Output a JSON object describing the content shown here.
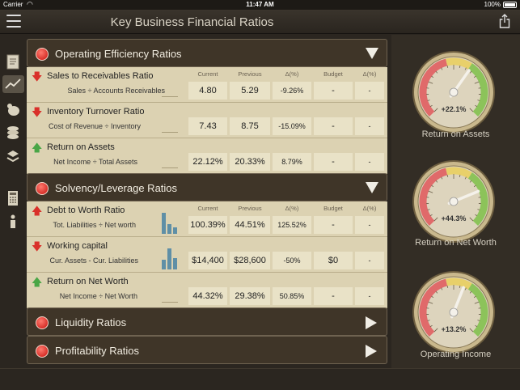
{
  "status": {
    "carrier": "Carrier",
    "time": "11:47 AM",
    "battery": "100%"
  },
  "nav": {
    "title": "Key Business Financial Ratios"
  },
  "columns": {
    "current": "Current",
    "previous": "Previous",
    "delta": "Δ(%)",
    "budget": "Budget",
    "delta_budget": "Δ(%)"
  },
  "sections": {
    "operating": {
      "title": "Operating Efficiency Ratios",
      "rows": [
        {
          "name": "Sales to Receivables Ratio",
          "formula": "Sales ÷ Accounts Receivables",
          "current": "4.80",
          "previous": "5.29",
          "delta": "-9.26%",
          "budget": "-",
          "delta_budget": "-",
          "trend": "down"
        },
        {
          "name": "Inventory Turnover Ratio",
          "formula": "Cost of Revenue ÷ Inventory",
          "current": "7.43",
          "previous": "8.75",
          "delta": "-15.09%",
          "budget": "-",
          "delta_budget": "-",
          "trend": "down"
        },
        {
          "name": "Return on Assets",
          "formula": "Net Income ÷ Total Assets",
          "current": "22.12%",
          "previous": "20.33%",
          "delta": "8.79%",
          "budget": "-",
          "delta_budget": "-",
          "trend": "up"
        }
      ]
    },
    "solvency": {
      "title": "Solvency/Leverage Ratios",
      "rows": [
        {
          "name": "Debt to Worth Ratio",
          "formula": "Tot. Liabilities ÷ Net worth",
          "current": "100.39%",
          "previous": "44.51%",
          "delta": "125.52%",
          "budget": "-",
          "delta_budget": "-",
          "trend": "up-red"
        },
        {
          "name": "Working capital",
          "formula": "Cur. Assets - Cur. Liabilities",
          "current": "$14,400",
          "previous": "$28,600",
          "delta": "-50%",
          "budget": "$0",
          "delta_budget": "-",
          "trend": "down"
        },
        {
          "name": "Return on Net Worth",
          "formula": "Net Income ÷ Net Worth",
          "current": "44.32%",
          "previous": "29.38%",
          "delta": "50.85%",
          "budget": "-",
          "delta_budget": "-",
          "trend": "up"
        }
      ]
    },
    "liquidity": {
      "title": "Liquidity Ratios"
    },
    "profitability": {
      "title": "Profitability Ratios"
    }
  },
  "gauges": [
    {
      "label": "Return on Assets",
      "value": "+22.1%",
      "level": 0.63
    },
    {
      "label": "Return on Net Worth",
      "value": "+44.3%",
      "level": 0.75
    },
    {
      "label": "Operating Income",
      "value": "+13.2%",
      "level": 0.58
    }
  ]
}
